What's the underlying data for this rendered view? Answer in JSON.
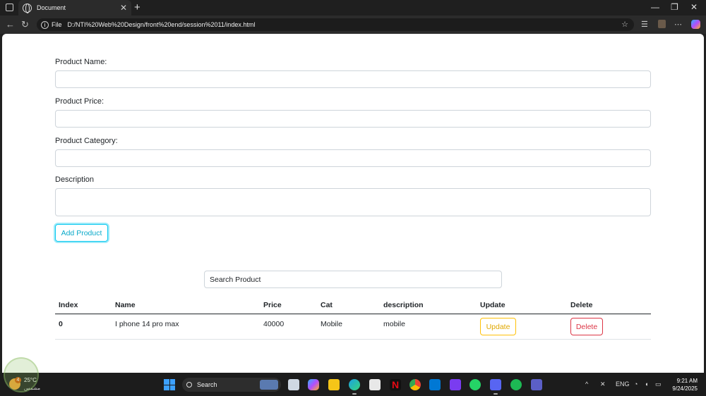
{
  "browser": {
    "tab_title": "Document",
    "tab_close": "✕",
    "new_tab": "+",
    "back": "←",
    "reload": "↻",
    "scheme_label": "File",
    "url": "D:/NTI%20Web%20Design/front%20end/session%2011/index.html",
    "win_minimize": "—",
    "win_restore": "❐",
    "win_close": "✕"
  },
  "form": {
    "name_label": "Product Name:",
    "price_label": "Product Price:",
    "category_label": "Product Category:",
    "description_label": "Description",
    "name_value": "",
    "price_value": "",
    "category_value": "",
    "description_value": "",
    "add_button": "Add Product"
  },
  "search": {
    "placeholder": "Search Product",
    "value": ""
  },
  "table": {
    "headers": [
      "Index",
      "Name",
      "Price",
      "Cat",
      "description",
      "Update",
      "Delete"
    ],
    "rows": [
      {
        "index": "0",
        "name": "I phone 14 pro max",
        "price": "40000",
        "cat": "Mobile",
        "description": "mobile",
        "update": "Update",
        "delete": "Delete"
      }
    ]
  },
  "taskbar": {
    "temperature": "25°C",
    "weather_badge": "4",
    "condition": "مشمس",
    "search_label": "Search",
    "language": "ENG",
    "time": "9:21 AM",
    "date": "9/24/2025"
  },
  "colors": {
    "info": "#0dcaf0",
    "warning": "#ffc107",
    "danger": "#dc3545"
  }
}
